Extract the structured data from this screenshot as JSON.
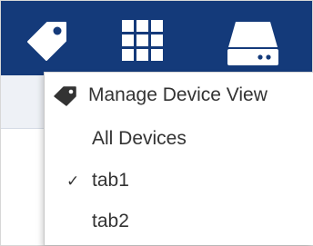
{
  "toolbar": {
    "icons": [
      "tag-icon",
      "grid-icon",
      "storage-icon"
    ],
    "background": "#143a7a",
    "icon_color": "#ffffff"
  },
  "menu": {
    "header_label": "Manage Device View",
    "header_icon": "tag-icon",
    "items": [
      {
        "label": "All Devices",
        "checked": false
      },
      {
        "label": "tab1",
        "checked": true
      },
      {
        "label": "tab2",
        "checked": false
      }
    ],
    "check_glyph": "✓",
    "text_color": "#333333"
  }
}
